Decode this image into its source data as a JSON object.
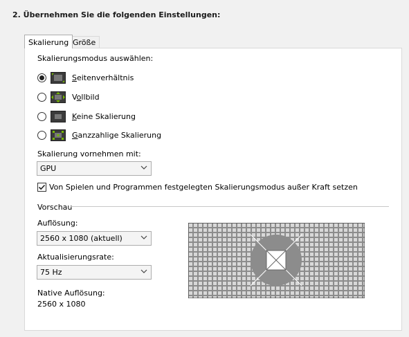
{
  "heading": "2. Übernehmen Sie die folgenden Einstellungen:",
  "tabs": [
    {
      "label": "Skalierung",
      "active": true
    },
    {
      "label": "Größe",
      "active": false
    }
  ],
  "scaling_mode": {
    "label": "Skalierungsmodus auswählen:",
    "options": [
      {
        "access_key": "S",
        "rest": "eitenverhältnis",
        "checked": true,
        "icon": "aspect-ratio-icon"
      },
      {
        "pre": "V",
        "access_key": "o",
        "rest": "llbild",
        "checked": false,
        "icon": "fullscreen-icon"
      },
      {
        "access_key": "K",
        "rest": "eine Skalierung",
        "checked": false,
        "icon": "no-scaling-icon"
      },
      {
        "access_key": "G",
        "rest": "anzzahlige Skalierung",
        "checked": false,
        "icon": "integer-scaling-icon"
      }
    ]
  },
  "perform_with": {
    "label": "Skalierung vornehmen mit:",
    "value": "GPU"
  },
  "override": {
    "label": "Von Spielen und Programmen festgelegten Skalierungsmodus außer Kraft setzen",
    "checked": true
  },
  "preview": {
    "label": "Vorschau",
    "resolution_label": "Auflösung:",
    "resolution_value": "2560 x 1080 (aktuell)",
    "refresh_label": "Aktualisierungsrate:",
    "refresh_value": "75 Hz",
    "native_label": "Native Auflösung:",
    "native_value": "2560 x 1080"
  },
  "colors": {
    "panel_bg": "#ffffff",
    "window_bg": "#f1f1f1",
    "icon_green": "#76b900",
    "preview_gray": "#8c8c8c"
  }
}
